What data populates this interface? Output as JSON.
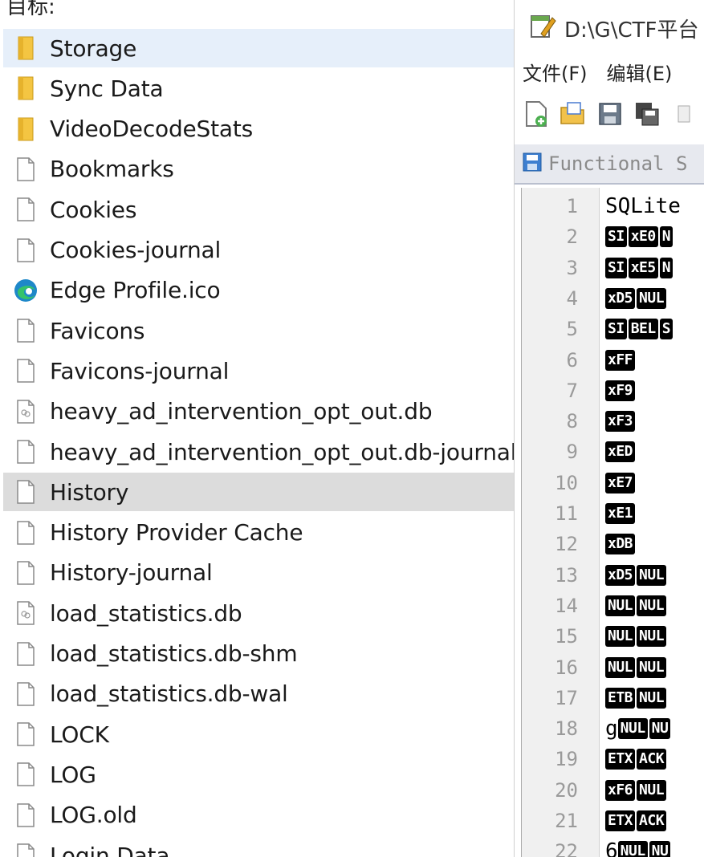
{
  "explorer": {
    "header_partial": "目标:",
    "items": [
      {
        "label": "Storage",
        "type": "folder",
        "state": "selected"
      },
      {
        "label": "Sync Data",
        "type": "folder",
        "state": ""
      },
      {
        "label": "VideoDecodeStats",
        "type": "folder",
        "state": ""
      },
      {
        "label": "Bookmarks",
        "type": "file",
        "state": ""
      },
      {
        "label": "Cookies",
        "type": "file",
        "state": ""
      },
      {
        "label": "Cookies-journal",
        "type": "file",
        "state": ""
      },
      {
        "label": "Edge Profile.ico",
        "type": "edge",
        "state": ""
      },
      {
        "label": "Favicons",
        "type": "file",
        "state": ""
      },
      {
        "label": "Favicons-journal",
        "type": "file",
        "state": ""
      },
      {
        "label": "heavy_ad_intervention_opt_out.db",
        "type": "db",
        "state": ""
      },
      {
        "label": "heavy_ad_intervention_opt_out.db-journal",
        "type": "file",
        "state": ""
      },
      {
        "label": "History",
        "type": "file",
        "state": "hover"
      },
      {
        "label": "History Provider Cache",
        "type": "file",
        "state": ""
      },
      {
        "label": "History-journal",
        "type": "file",
        "state": ""
      },
      {
        "label": "load_statistics.db",
        "type": "db",
        "state": ""
      },
      {
        "label": "load_statistics.db-shm",
        "type": "file",
        "state": ""
      },
      {
        "label": "load_statistics.db-wal",
        "type": "file",
        "state": ""
      },
      {
        "label": "LOCK",
        "type": "file",
        "state": ""
      },
      {
        "label": "LOG",
        "type": "file",
        "state": ""
      },
      {
        "label": "LOG.old",
        "type": "file",
        "state": ""
      },
      {
        "label": "Login Data",
        "type": "file",
        "state": ""
      }
    ]
  },
  "editor": {
    "title": "D:\\G\\CTF平台",
    "menu": [
      "文件(F)",
      "编辑(E)"
    ],
    "toolbar_icons": [
      "new-file-icon",
      "open-file-icon",
      "save-icon",
      "save-all-icon",
      "close-icon"
    ],
    "tab_label": "Functional S",
    "lines": [
      {
        "n": "1",
        "text": "SQLite",
        "tokens": []
      },
      {
        "n": "2",
        "text": "",
        "tokens": [
          "SI",
          "xE0",
          "N"
        ]
      },
      {
        "n": "3",
        "text": "",
        "tokens": [
          "SI",
          "xE5",
          "N"
        ]
      },
      {
        "n": "4",
        "text": "",
        "tokens": [
          "xD5",
          "NUL"
        ]
      },
      {
        "n": "5",
        "text": "",
        "tokens": [
          "SI",
          "BEL",
          "S"
        ]
      },
      {
        "n": "6",
        "text": "",
        "tokens": [
          "xFF"
        ]
      },
      {
        "n": "7",
        "text": "",
        "tokens": [
          "xF9"
        ]
      },
      {
        "n": "8",
        "text": "",
        "tokens": [
          "xF3"
        ]
      },
      {
        "n": "9",
        "text": "",
        "tokens": [
          "xED"
        ]
      },
      {
        "n": "10",
        "text": "",
        "tokens": [
          "xE7"
        ]
      },
      {
        "n": "11",
        "text": "",
        "tokens": [
          "xE1"
        ]
      },
      {
        "n": "12",
        "text": "",
        "tokens": [
          "xDB"
        ]
      },
      {
        "n": "13",
        "text": "",
        "tokens": [
          "xD5",
          "NUL"
        ]
      },
      {
        "n": "14",
        "text": "",
        "tokens": [
          "NUL",
          "NUL"
        ]
      },
      {
        "n": "15",
        "text": "",
        "tokens": [
          "NUL",
          "NUL"
        ]
      },
      {
        "n": "16",
        "text": "",
        "tokens": [
          "NUL",
          "NUL"
        ]
      },
      {
        "n": "17",
        "text": "",
        "tokens": [
          "ETB",
          "NUL"
        ]
      },
      {
        "n": "18",
        "text": "g",
        "tokens": [
          "NUL",
          "NU"
        ]
      },
      {
        "n": "19",
        "text": "",
        "tokens": [
          "ETX",
          "ACK"
        ]
      },
      {
        "n": "20",
        "text": "",
        "tokens": [
          "xF6",
          "NUL"
        ]
      },
      {
        "n": "21",
        "text": "",
        "tokens": [
          "ETX",
          "ACK"
        ]
      },
      {
        "n": "22",
        "text": "6",
        "tokens": [
          "NUL",
          "NU"
        ]
      }
    ]
  }
}
